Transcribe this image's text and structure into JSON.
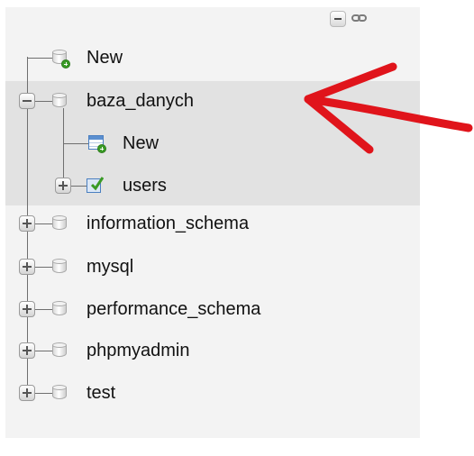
{
  "tree": {
    "root_new_label": "New",
    "databases": [
      {
        "name": "baza_danych",
        "expanded": true,
        "selected": true,
        "children": [
          {
            "label": "New",
            "icon": "new-table-icon"
          },
          {
            "label": "users",
            "icon": "table-icon"
          }
        ]
      },
      {
        "name": "information_schema",
        "expanded": false
      },
      {
        "name": "mysql",
        "expanded": false
      },
      {
        "name": "performance_schema",
        "expanded": false
      },
      {
        "name": "phpmyadmin",
        "expanded": false
      },
      {
        "name": "test",
        "expanded": false
      }
    ]
  },
  "controls": {
    "collapse_icon": "collapse-all-icon",
    "link_icon": "link-icon"
  },
  "annotation": {
    "arrow_color": "#e0141b"
  },
  "colors": {
    "selected_bg": "#e2e2e2",
    "panel_bg": "#f3f3f3"
  }
}
